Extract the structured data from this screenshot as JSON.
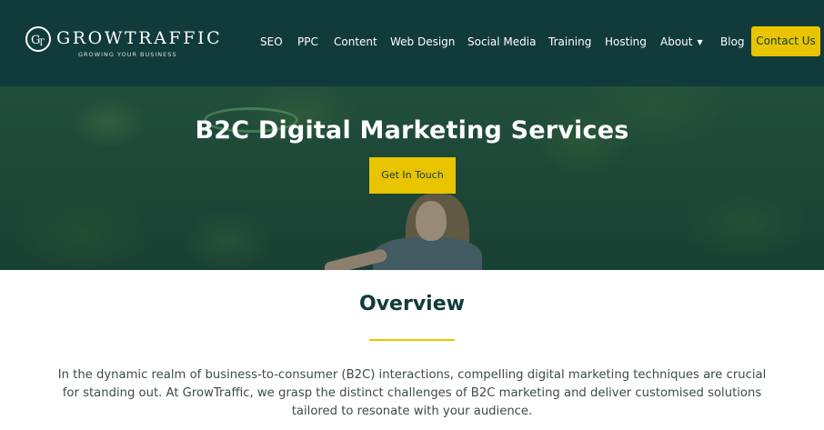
{
  "header": {
    "logo": {
      "wordmark": "GROWTRAFFIC",
      "tagline": "GROWING YOUR BUSINESS"
    },
    "nav": [
      {
        "label": "SEO"
      },
      {
        "label": "PPC"
      },
      {
        "label": "Content"
      },
      {
        "label": "Web Design"
      },
      {
        "label": "Social Media"
      },
      {
        "label": "Training"
      },
      {
        "label": "Hosting"
      },
      {
        "label": "About",
        "icon": "chevron-down-icon"
      },
      {
        "label": "Blog"
      }
    ],
    "contact_label": "Contact Us"
  },
  "hero": {
    "title": "B2C Digital Marketing Services",
    "button_label": "Get In Touch"
  },
  "overview": {
    "title": "Overview",
    "body": "In the dynamic realm of business-to-consumer (B2C) interactions, compelling digital marketing techniques are crucial for standing out. At GrowTraffic, we grasp the distinct challenges of B2C marketing and deliver customised solutions tailored to resonate with your audience."
  },
  "colors": {
    "header_bg": "#113a3b",
    "accent": "#e8c500",
    "heading": "#113a3b",
    "body_text": "#3e4a4a"
  }
}
